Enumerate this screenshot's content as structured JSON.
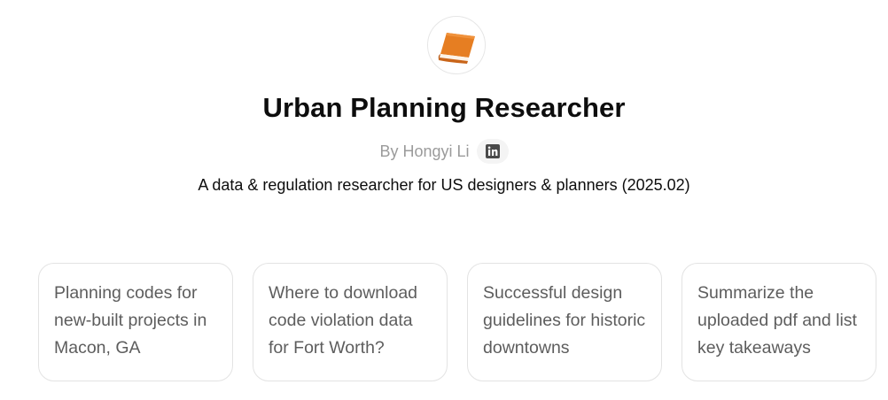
{
  "gpt": {
    "avatar_icon": "orange-book-icon",
    "title": "Urban Planning Researcher",
    "author": "By Hongyi Li",
    "social_icon": "linkedin-icon",
    "description": "A data & regulation researcher for US designers & planners (2025.02)"
  },
  "starters": [
    {
      "text": "Planning codes for new-built projects in Macon, GA"
    },
    {
      "text": "Where to download code violation data for Fort Worth?"
    },
    {
      "text": "Successful design guidelines for historic downtowns"
    },
    {
      "text": "Summarize the uploaded pdf and list key takeaways"
    }
  ],
  "colors": {
    "accent": "#E67E22",
    "card_border": "#E3E3E3",
    "muted_text": "#9B9B9B"
  }
}
